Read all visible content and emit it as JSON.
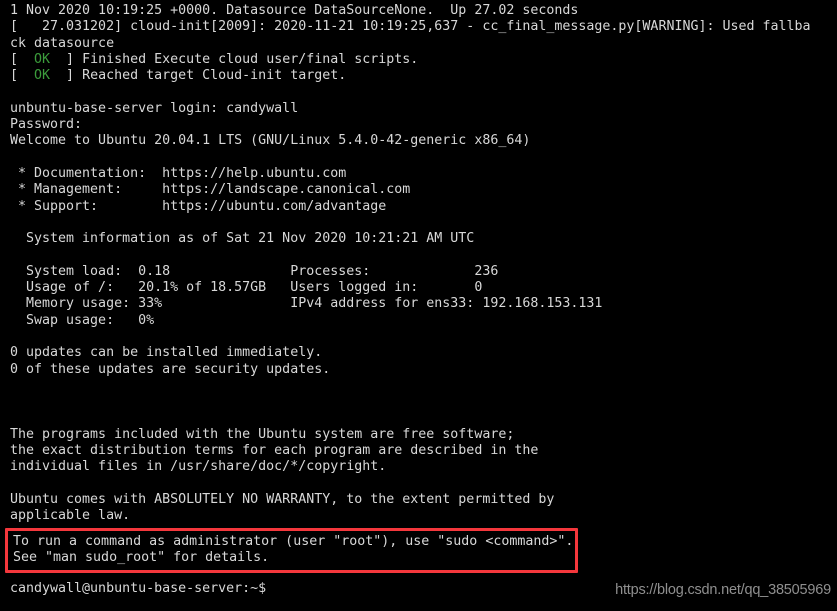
{
  "terminal": {
    "title": "Ubuntu 20.04.1 LTS console",
    "background_color": "#000000",
    "foreground_color": "#d8d8d8",
    "ok_color": "#3c9d3c",
    "highlight_color": "#f4373c",
    "watermark_color": "#8f8f8f",
    "lines": [
      {
        "id": "line-0",
        "text": "1 Nov 2020 10:19:25 +0000. Datasource DataSourceNone.  Up 27.02 seconds"
      },
      {
        "id": "line-1",
        "text": "[   27.031202] cloud-init[2009]: 2020-11-21 10:19:25,637 - cc_final_message.py[WARNING]: Used fallba"
      },
      {
        "id": "line-2",
        "text": "ck datasource"
      },
      {
        "id": "line-3",
        "pre": "[  ",
        "ok": "OK",
        "post": "  ] Finished Execute cloud user/final scripts."
      },
      {
        "id": "line-4",
        "pre": "[  ",
        "ok": "OK",
        "post": "  ] Reached target Cloud-init target."
      },
      {
        "id": "line-5",
        "text": ""
      },
      {
        "id": "line-6",
        "text": "unbuntu-base-server login: candywall"
      },
      {
        "id": "line-7",
        "text": "Password:"
      },
      {
        "id": "line-8",
        "text": "Welcome to Ubuntu 20.04.1 LTS (GNU/Linux 5.4.0-42-generic x86_64)"
      },
      {
        "id": "line-9",
        "text": ""
      },
      {
        "id": "line-10",
        "text": " * Documentation:  https://help.ubuntu.com"
      },
      {
        "id": "line-11",
        "text": " * Management:     https://landscape.canonical.com"
      },
      {
        "id": "line-12",
        "text": " * Support:        https://ubuntu.com/advantage"
      },
      {
        "id": "line-13",
        "text": ""
      },
      {
        "id": "line-14",
        "text": "  System information as of Sat 21 Nov 2020 10:21:21 AM UTC"
      },
      {
        "id": "line-15",
        "text": ""
      },
      {
        "id": "line-16",
        "text": "  System load:  0.18               Processes:             236"
      },
      {
        "id": "line-17",
        "text": "  Usage of /:   20.1% of 18.57GB   Users logged in:       0"
      },
      {
        "id": "line-18",
        "text": "  Memory usage: 33%                IPv4 address for ens33: 192.168.153.131"
      },
      {
        "id": "line-19",
        "text": "  Swap usage:   0%"
      },
      {
        "id": "line-20",
        "text": ""
      },
      {
        "id": "line-21",
        "text": "0 updates can be installed immediately."
      },
      {
        "id": "line-22",
        "text": "0 of these updates are security updates."
      },
      {
        "id": "line-23",
        "text": ""
      },
      {
        "id": "line-24",
        "text": ""
      },
      {
        "id": "line-25",
        "text": ""
      },
      {
        "id": "line-26",
        "text": "The programs included with the Ubuntu system are free software;"
      },
      {
        "id": "line-27",
        "text": "the exact distribution terms for each program are described in the"
      },
      {
        "id": "line-28",
        "text": "individual files in /usr/share/doc/*/copyright."
      },
      {
        "id": "line-29",
        "text": ""
      },
      {
        "id": "line-30",
        "text": "Ubuntu comes with ABSOLUTELY NO WARRANTY, to the extent permitted by"
      },
      {
        "id": "line-31",
        "text": "applicable law."
      }
    ],
    "sudo_notice": {
      "line1": "To run a command as administrator (user \"root\"), use \"sudo <command>\".",
      "line2": "See \"man sudo_root\" for details."
    },
    "prompt": "candywall@unbuntu-base-server:~$ ",
    "watermark": "https://blog.csdn.net/qq_38505969"
  }
}
